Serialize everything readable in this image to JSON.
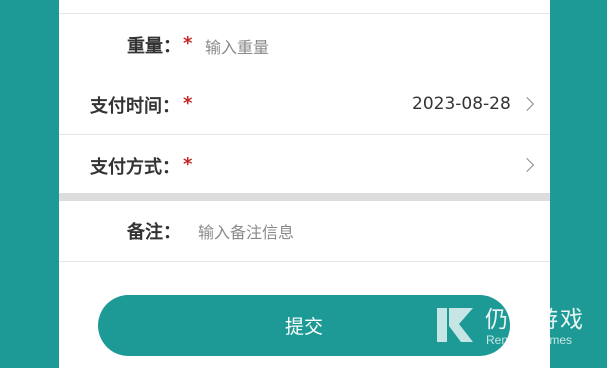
{
  "form": {
    "weight": {
      "label": "重量：",
      "required": "*",
      "placeholder": "输入重量"
    },
    "pay_time": {
      "label": "支付时间：",
      "required": "*",
      "value": "2023-08-28"
    },
    "pay_method": {
      "label": "支付方式：",
      "required": "*"
    },
    "remark": {
      "label": "备注：",
      "placeholder": "输入备注信息"
    },
    "submit_label": "提交"
  },
  "watermark": {
    "title": "仍玩游戏",
    "subtitle": "Renwan Games"
  },
  "colors": {
    "accent": "#1e9a96",
    "required": "#c62828"
  }
}
